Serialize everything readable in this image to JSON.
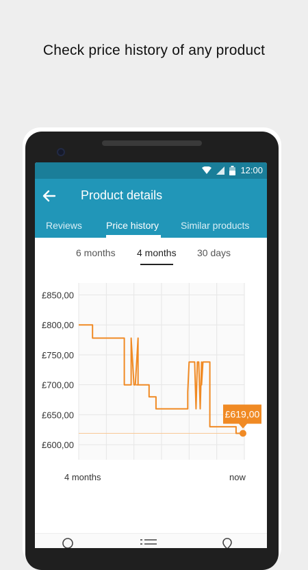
{
  "promo": {
    "headline": "Check price history of any product"
  },
  "statusbar": {
    "time": "12:00",
    "icons": [
      "wifi-icon",
      "signal-icon",
      "battery-icon"
    ]
  },
  "appbar": {
    "title": "Product details",
    "back_icon": "arrow-back-icon"
  },
  "tabs": [
    {
      "label": "Reviews",
      "active": false
    },
    {
      "label": "Price history",
      "active": true
    },
    {
      "label": "Similar products",
      "active": false
    }
  ],
  "range": [
    {
      "label": "6 months",
      "active": false
    },
    {
      "label": "4 months",
      "active": true
    },
    {
      "label": "30 days",
      "active": false
    }
  ],
  "bottom_nav": {
    "icons": [
      "search-icon",
      "list-icon",
      "location-icon"
    ]
  },
  "colors": {
    "primary": "#2196b8",
    "statusbar": "#1a7e99",
    "line": "#f08a24"
  },
  "chart_data": {
    "type": "line",
    "title": "",
    "xlabel": "",
    "ylabel": "",
    "y_ticks": [
      "£600,00",
      "£650,00",
      "£700,00",
      "£750,00",
      "£800,00",
      "£850,00"
    ],
    "ylim": [
      575,
      870
    ],
    "x_start_label": "4 months",
    "x_end_label": "now",
    "x_domain_days": [
      0,
      120
    ],
    "series": [
      {
        "x": [
          0,
          10,
          10,
          33,
          33,
          38,
          38,
          40,
          41,
          43,
          43,
          42,
          43,
          45,
          45,
          51,
          51,
          56,
          56,
          79,
          79,
          80,
          81,
          84,
          85,
          86,
          87,
          88,
          89,
          89,
          90,
          90,
          95,
          95,
          110,
          114,
          114,
          119
        ],
        "y": [
          800,
          800,
          778,
          778,
          700,
          700,
          778,
          700,
          700,
          778,
          700,
          700,
          700,
          700,
          700,
          700,
          680,
          680,
          660,
          660,
          688,
          738,
          738,
          738,
          660,
          738,
          738,
          660,
          738,
          700,
          738,
          738,
          738,
          630,
          630,
          630,
          619,
          619
        ]
      }
    ],
    "reference_line": 619,
    "highlight": {
      "label": "£619,00",
      "value": 619
    },
    "grid": true
  }
}
